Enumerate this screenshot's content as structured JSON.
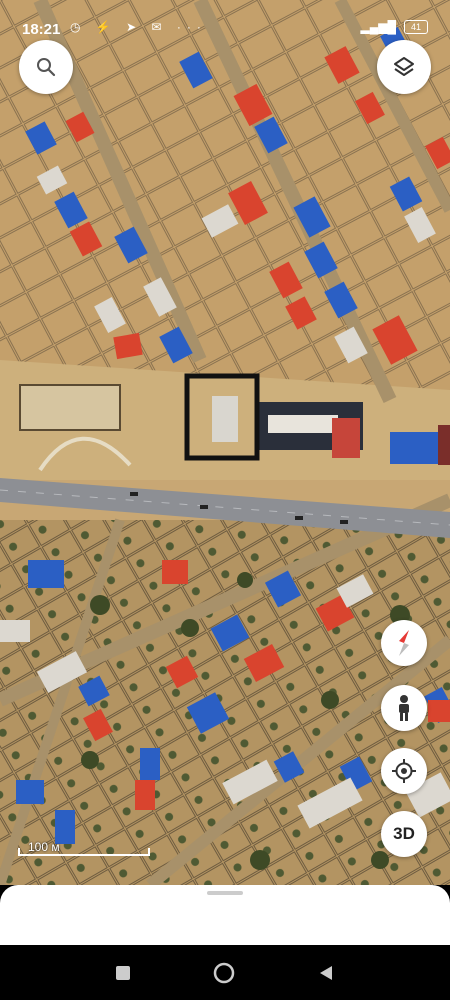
{
  "status_bar": {
    "time": "18:21",
    "left_icons": "◷ ⚡ ➤ ✉ ···",
    "battery": "41"
  },
  "map": {
    "scale_label": "100 м",
    "mode_3d_label": "3D",
    "icons": {
      "search": "search-icon",
      "layers": "layers-icon",
      "compass": "compass-icon",
      "street_view": "pegman-icon",
      "my_location": "my-location-icon"
    },
    "colors": {
      "terrain": "#c8a774",
      "road": "#8d8f94",
      "roof_blue": "#2b5fc4",
      "roof_red": "#d9442e",
      "marker_box": "#111111"
    }
  },
  "nav_bar": {
    "recent_label": "■",
    "home_label": "◉",
    "back_label": "◀"
  }
}
